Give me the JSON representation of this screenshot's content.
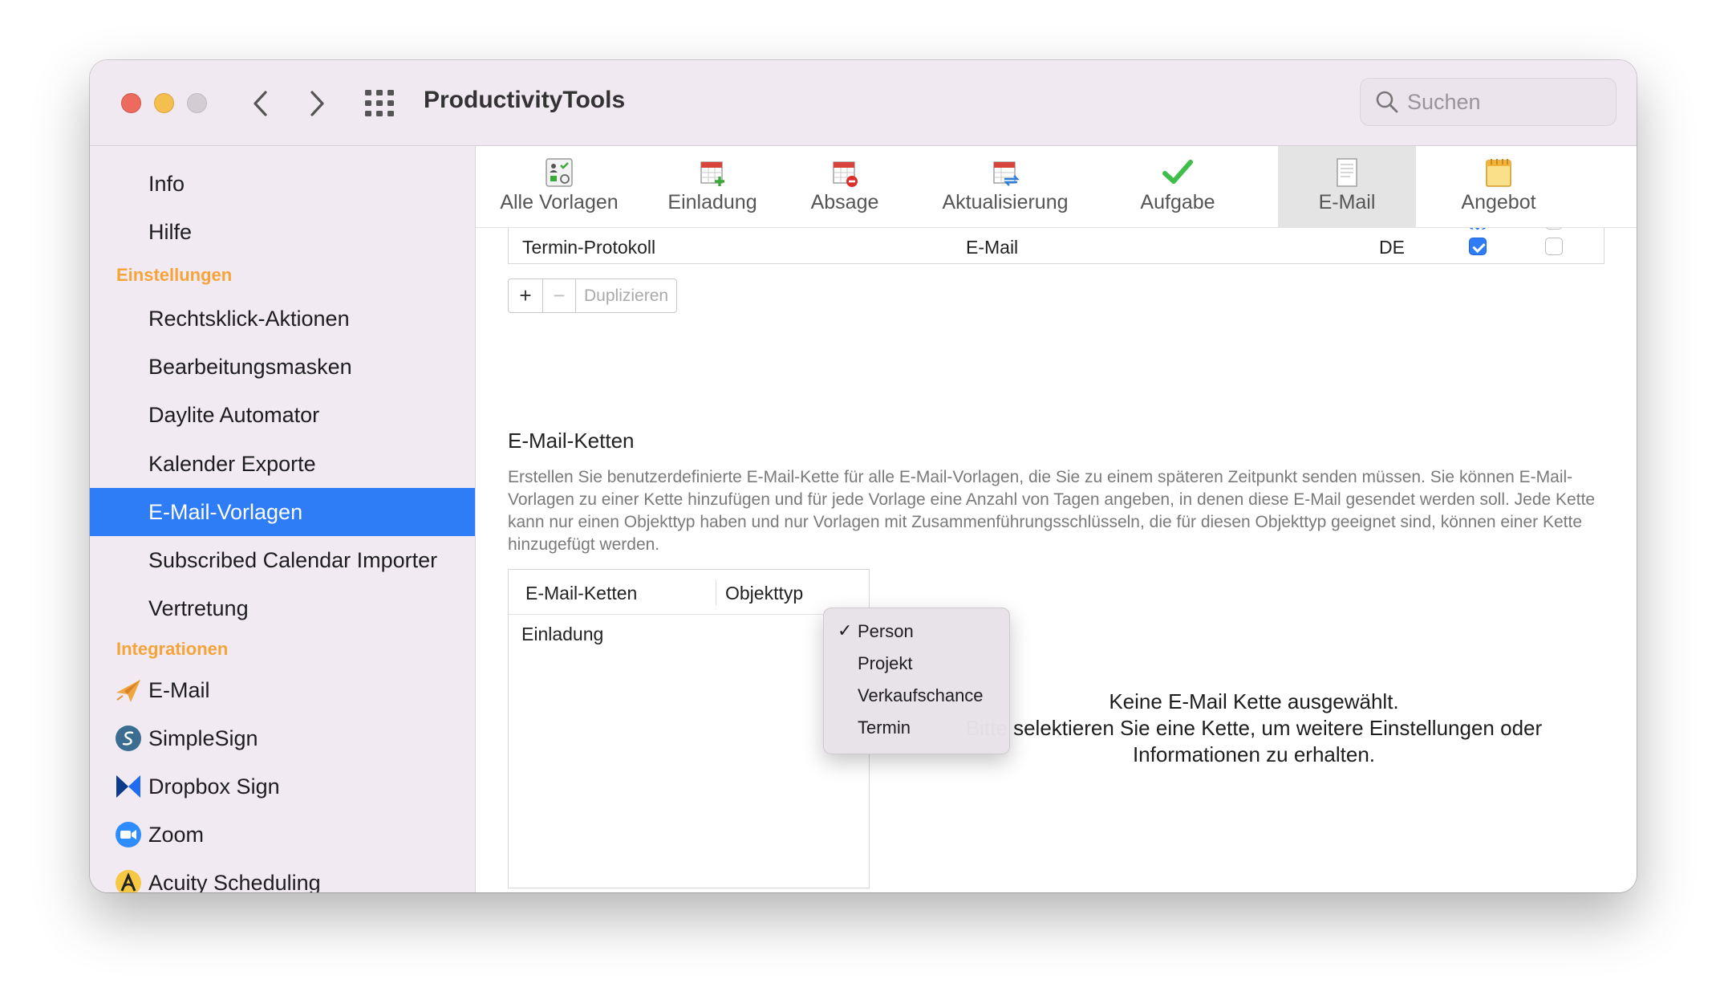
{
  "window": {
    "title": "ProductivityTools",
    "search_placeholder": "Suchen"
  },
  "sidebar": {
    "items_top": [
      {
        "label": "Info"
      },
      {
        "label": "Hilfe"
      }
    ],
    "section_settings": "Einstellungen",
    "settings_items": [
      {
        "label": "Rechtsklick-Aktionen"
      },
      {
        "label": "Bearbeitungsmasken"
      },
      {
        "label": "Daylite Automator"
      },
      {
        "label": "Kalender Exporte"
      },
      {
        "label": "E-Mail-Vorlagen",
        "selected": true
      },
      {
        "label": "Subscribed Calendar Importer"
      },
      {
        "label": "Vertretung"
      }
    ],
    "section_integrations": "Integrationen",
    "integration_items": [
      {
        "label": "E-Mail",
        "icon": "paper-plane-icon"
      },
      {
        "label": "SimpleSign",
        "icon": "simplesign-icon"
      },
      {
        "label": "Dropbox Sign",
        "icon": "dropbox-sign-icon"
      },
      {
        "label": "Zoom",
        "icon": "zoom-icon"
      },
      {
        "label": "Acuity Scheduling",
        "icon": "acuity-icon"
      }
    ],
    "selected_color": "#2e7cf6",
    "section_color": "#f5a43a"
  },
  "tabs": [
    {
      "label": "Alle Vorlagen",
      "icon": "all-templates-icon"
    },
    {
      "label": "Einladung",
      "icon": "invitation-calendar-icon"
    },
    {
      "label": "Absage",
      "icon": "cancellation-calendar-icon"
    },
    {
      "label": "Aktualisierung",
      "icon": "update-calendar-icon"
    },
    {
      "label": "Aufgabe",
      "icon": "checkmark-icon"
    },
    {
      "label": "E-Mail",
      "icon": "document-icon",
      "active": true
    },
    {
      "label": "Angebot",
      "icon": "notepad-icon"
    }
  ],
  "templates_table": {
    "rows": [
      {
        "name": "Termin-Protokoll",
        "type": "E-Mail",
        "lang": "DE",
        "checked_a": true,
        "checked_b": false
      }
    ]
  },
  "template_buttons": {
    "add": "+",
    "remove": "−",
    "duplicate": "Duplizieren"
  },
  "chains_section": {
    "title": "E-Mail-Ketten",
    "description": "Erstellen Sie benutzerdefinierte E-Mail-Kette für alle E-Mail-Vorlagen, die Sie zu einem späteren Zeitpunkt senden müssen. Sie können E-Mail-Vorlagen zu einer Kette hinzufügen und für jede Vorlage eine Anzahl von Tagen angeben, in denen diese E-Mail gesendet werden soll. Jede Kette kann nur einen Objekttyp haben und nur Vorlagen mit Zusammenführungsschlüsseln, die für diesen Objekttyp geeignet sind, können einer Kette hinzugefügt werden.",
    "columns": [
      "E-Mail-Ketten",
      "Objekttyp"
    ],
    "rows": [
      {
        "name": "Einladung"
      }
    ],
    "add": "+",
    "remove": "−",
    "empty_line1": "Keine E-Mail Kette ausgewählt.",
    "empty_line2": "Bitte selektieren Sie eine Kette, um weitere Einstellungen oder Informationen zu erhalten."
  },
  "objecttype_menu": {
    "options": [
      {
        "label": "Person",
        "checked": true
      },
      {
        "label": "Projekt",
        "checked": false
      },
      {
        "label": "Verkaufschance",
        "checked": false
      },
      {
        "label": "Termin",
        "checked": false
      }
    ],
    "check_glyph": "✓"
  }
}
